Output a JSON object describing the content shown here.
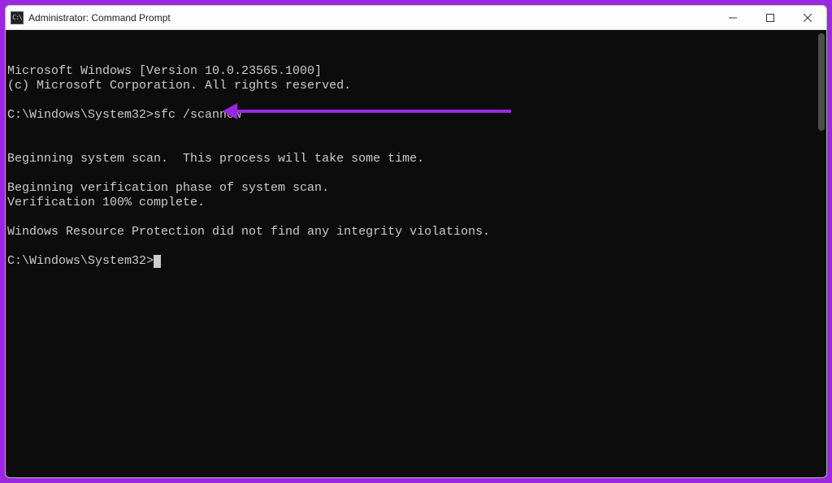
{
  "window": {
    "title": "Administrator: Command Prompt",
    "icon_glyph": "C:\\"
  },
  "terminal": {
    "lines": [
      "Microsoft Windows [Version 10.0.23565.1000]",
      "(c) Microsoft Corporation. All rights reserved.",
      "",
      "C:\\Windows\\System32>sfc /scannow",
      "",
      "",
      "Beginning system scan.  This process will take some time.",
      "",
      "Beginning verification phase of system scan.",
      "Verification 100% complete.",
      "",
      "Windows Resource Protection did not find any integrity violations.",
      "",
      "C:\\Windows\\System32>"
    ],
    "prompt_line_index": 13
  },
  "annotation": {
    "color": "#9c27e0"
  }
}
